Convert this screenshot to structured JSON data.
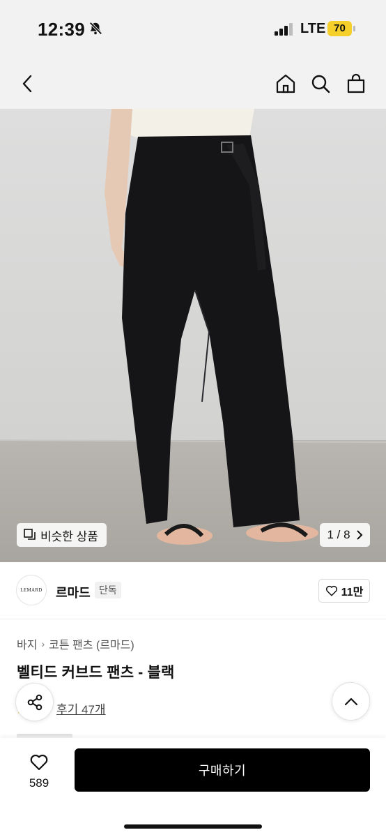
{
  "status_bar": {
    "time": "12:39",
    "network": "LTE",
    "battery": "70",
    "battery_color": "#f5cf2a"
  },
  "nav": {
    "back_icon": "chevron-left-icon",
    "home_icon": "home-icon",
    "search_icon": "search-icon",
    "bag_icon": "shopping-bag-icon"
  },
  "gallery": {
    "similar_label": "비슷한 상품",
    "page_current": "1",
    "page_total": "8",
    "page_text": "1 / 8"
  },
  "brand": {
    "logo_text": "LEMARD",
    "name": "르마드",
    "badge": "단독",
    "like_count": "11만"
  },
  "breadcrumb": {
    "items": [
      "바지",
      "코튼 팬츠 (르마드)"
    ],
    "separator": "›"
  },
  "product": {
    "title": "벨티드 커브드 팬츠 - 블랙",
    "review_text": "후기 47개"
  },
  "bottom_bar": {
    "wish_count": "589",
    "buy_label": "구매하기",
    "buy_bg": "#000000"
  }
}
